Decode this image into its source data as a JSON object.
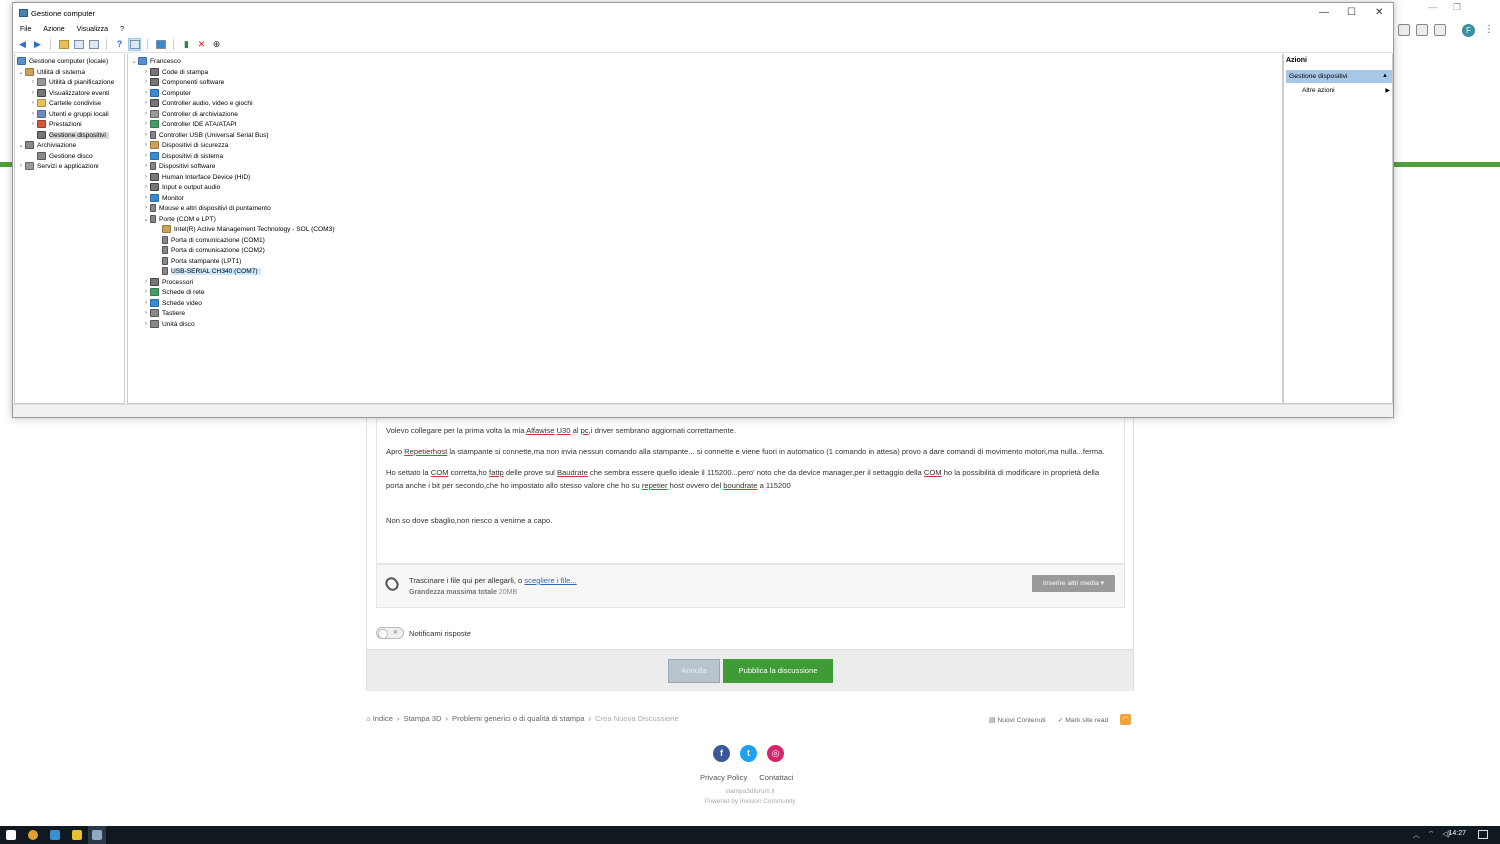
{
  "window": {
    "title": "Gestione computer",
    "controls": [
      "—",
      "☐",
      "✕"
    ],
    "menu": [
      "File",
      "Azione",
      "Visualizza",
      "?"
    ]
  },
  "left_tree": {
    "root": "Gestione computer (locale)",
    "items": [
      {
        "label": "Utilità di sistema"
      },
      {
        "label": "Utilità di pianificazione"
      },
      {
        "label": "Visualizzatore eventi"
      },
      {
        "label": "Cartelle condivise"
      },
      {
        "label": "Utenti e gruppi locali"
      },
      {
        "label": "Prestazioni"
      },
      {
        "label": "Gestione dispositivi"
      },
      {
        "label": "Archiviazione"
      },
      {
        "label": "Gestione disco"
      },
      {
        "label": "Servizi e applicazioni"
      }
    ]
  },
  "device_tree": {
    "root": "Francesco",
    "categories": [
      "Code di stampa",
      "Componenti software",
      "Computer",
      "Controller audio, video e giochi",
      "Controller di archiviazione",
      "Controller IDE ATA/ATAPI",
      "Controller USB (Universal Serial Bus)",
      "Dispositivi di sicurezza",
      "Dispositivi di sistema",
      "Dispositivi software",
      "Human Interface Device (HID)",
      "Input e output audio",
      "Monitor",
      "Mouse e altri dispositivi di puntamento",
      "Porte (COM e LPT)"
    ],
    "ports": [
      "Intel(R) Active Management Technology - SOL (COM3)",
      "Porta di comunicazione (COM1)",
      "Porta di comunicazione (COM2)",
      "Porta stampante (LPT1)",
      "USB-SERIAL CH340 (COM7)"
    ],
    "after": [
      "Processori",
      "Schede di rete",
      "Schede video",
      "Tastiere",
      "Unità disco"
    ]
  },
  "actions": {
    "header": "Azioni",
    "selected": "Gestione dispositivi",
    "item": "Altre azioni"
  },
  "forum": {
    "p1": {
      "a": "Volevo collegare per la prima volta la mia ",
      "b": "Alfawise",
      "c": " ",
      "d": "U30",
      "e": " al ",
      "f": "pc",
      "g": ",i driver sembrano aggiornati correttamente."
    },
    "p2": {
      "a": "Apro ",
      "b": "Repetierhost",
      "c": " la stampante si connette,ma non invia nessun comando alla stampante... si connette e viene fuori in automatico (1 comando in attesa) provo a dare comandi di movimento motori,ma nulla...ferma."
    },
    "p3": {
      "a": "Ho settato la ",
      "b": "COM",
      "c": " corretta,ho ",
      "d": "fattp",
      "e": " delle prove sul ",
      "f": "Baudrate",
      "g": " che sembra essere quello ideale il 115200...pero' noto che da device manager,per il settaggio della ",
      "h": "COM",
      "i": " ho la possibilità di modificare in proprietà della porta anche i bit per secondo,che ho impostato allo stesso valore che ho su ",
      "j": "repetier",
      "k": " host ovvero del ",
      "l": "boundrate",
      "m": " a 115200"
    },
    "p4": "Non so dove sbaglio,non riesco a venirne a capo.",
    "attach_text": "Trascinare i file qui per allegarli, o ",
    "attach_link": "scegliere i file...",
    "attach_sub_label": "Grandezza massima totale",
    "attach_sub_value": "20MB",
    "media_button": "Inserire altri media ▾",
    "notify_label": "Notificami risposte",
    "cancel": "Annulla",
    "publish": "Pubblica la discussione"
  },
  "breadcrumb": {
    "items": [
      "⌂ Indice",
      "›",
      "Stampa 3D",
      "›",
      "Problemi generici o di qualità di stampa",
      "›"
    ],
    "current": "Crea Nuova Discussione",
    "new_content": "Nuovi Contenuti",
    "mark_read": "✓  Mark site read"
  },
  "footer": {
    "privacy": "Privacy Policy",
    "contact": "Contattaci",
    "site": "stampa3dforum.it",
    "powered": "Powered by Invision Community"
  },
  "taskbar": {
    "time": "14:27"
  }
}
